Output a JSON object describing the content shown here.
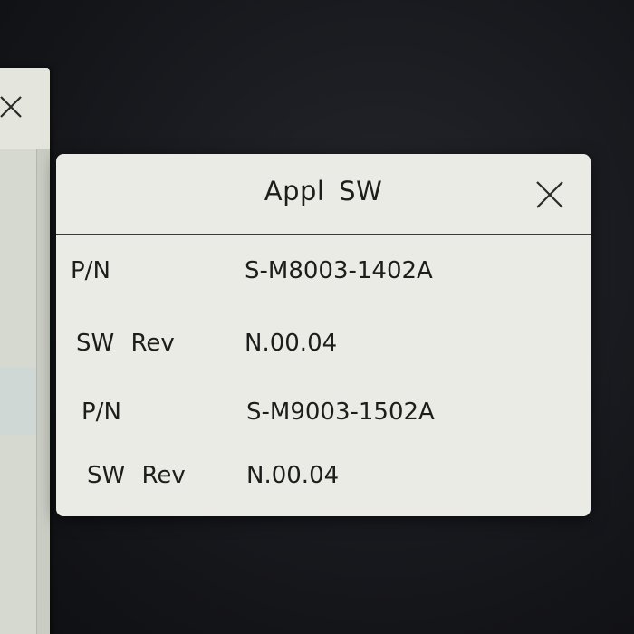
{
  "dialog": {
    "title": "Appl SW",
    "close_icon": "close-icon",
    "rows": [
      {
        "label": "P/N",
        "value": "S-M8003-1402A"
      },
      {
        "label": "SW Rev",
        "value": "N.00.04"
      },
      {
        "label": "P/N",
        "value": "S-M9003-1502A"
      },
      {
        "label": "SW Rev",
        "value": "N.00.04"
      }
    ]
  },
  "background_window": {
    "close_icon": "close-icon"
  },
  "colors": {
    "dialog_bg": "#eaebe4",
    "text": "#1d1e1c",
    "screen_bg": "#17181c"
  }
}
